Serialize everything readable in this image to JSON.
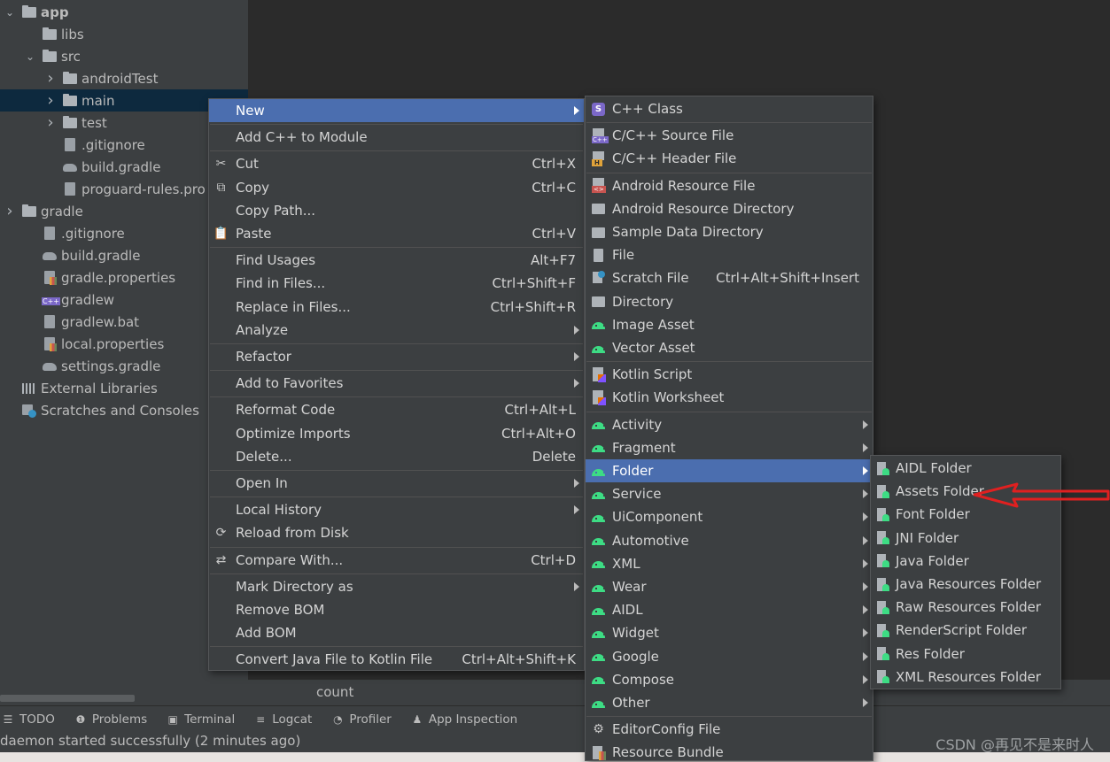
{
  "project_tree": [
    {
      "label": "app",
      "arrow": "down",
      "icon": "module-folder-icon",
      "kind": "folder"
    },
    {
      "label": "libs",
      "arrow": "",
      "icon": "folder-icon",
      "kind": "folder"
    },
    {
      "label": "src",
      "arrow": "down",
      "icon": "folder-icon",
      "kind": "folder"
    },
    {
      "label": "androidTest",
      "arrow": "right",
      "icon": "folder-icon",
      "kind": "folder"
    },
    {
      "label": "main",
      "arrow": "right",
      "icon": "folder-icon",
      "kind": "folder",
      "selected": true
    },
    {
      "label": "test",
      "arrow": "right",
      "icon": "folder-icon",
      "kind": "folder"
    },
    {
      "label": ".gitignore",
      "arrow": "",
      "icon": "gitignore-file-icon",
      "kind": "file"
    },
    {
      "label": "build.gradle",
      "arrow": "",
      "icon": "gradle-icon",
      "kind": "gradle"
    },
    {
      "label": "proguard-rules.pro",
      "arrow": "",
      "icon": "file-icon",
      "kind": "file"
    },
    {
      "label": "gradle",
      "arrow": "right",
      "icon": "folder-icon",
      "kind": "folder"
    },
    {
      "label": ".gitignore",
      "arrow": "",
      "icon": "gitignore-file-icon",
      "kind": "file"
    },
    {
      "label": "build.gradle",
      "arrow": "",
      "icon": "gradle-icon",
      "kind": "gradle"
    },
    {
      "label": "gradle.properties",
      "arrow": "",
      "icon": "properties-icon",
      "kind": "props"
    },
    {
      "label": "gradlew",
      "arrow": "",
      "icon": "cpp-file-icon",
      "kind": "cpp"
    },
    {
      "label": "gradlew.bat",
      "arrow": "",
      "icon": "file-icon",
      "kind": "file"
    },
    {
      "label": "local.properties",
      "arrow": "",
      "icon": "properties-icon",
      "kind": "props"
    },
    {
      "label": "settings.gradle",
      "arrow": "",
      "icon": "gradle-icon",
      "kind": "gradle"
    },
    {
      "label": "External Libraries",
      "arrow": "",
      "icon": "library-icon",
      "kind": "lib"
    },
    {
      "label": "Scratches and Consoles",
      "arrow": "",
      "icon": "scratches-icon",
      "kind": "scratch"
    }
  ],
  "editor": {
    "status_text": "count"
  },
  "context_menu": {
    "items": [
      {
        "label": "New",
        "shortcut": "",
        "submenu": true,
        "highlighted": true,
        "icon": ""
      },
      {
        "sep": true
      },
      {
        "label": "Add C++ to Module",
        "shortcut": "",
        "submenu": false,
        "icon": ""
      },
      {
        "sep": true
      },
      {
        "label": "Cut",
        "shortcut": "Ctrl+X",
        "submenu": false,
        "icon": "scissors-icon",
        "glyph": "✂"
      },
      {
        "label": "Copy",
        "shortcut": "Ctrl+C",
        "submenu": false,
        "icon": "copy-icon",
        "glyph": "⧉"
      },
      {
        "label": "Copy Path...",
        "shortcut": "",
        "submenu": false,
        "icon": ""
      },
      {
        "label": "Paste",
        "shortcut": "Ctrl+V",
        "submenu": false,
        "icon": "clipboard-icon",
        "glyph": "📋"
      },
      {
        "sep": true
      },
      {
        "label": "Find Usages",
        "shortcut": "Alt+F7",
        "submenu": false,
        "icon": ""
      },
      {
        "label": "Find in Files...",
        "shortcut": "Ctrl+Shift+F",
        "submenu": false,
        "icon": ""
      },
      {
        "label": "Replace in Files...",
        "shortcut": "Ctrl+Shift+R",
        "submenu": false,
        "icon": ""
      },
      {
        "label": "Analyze",
        "shortcut": "",
        "submenu": true,
        "icon": ""
      },
      {
        "sep": true
      },
      {
        "label": "Refactor",
        "shortcut": "",
        "submenu": true,
        "icon": ""
      },
      {
        "sep": true
      },
      {
        "label": "Add to Favorites",
        "shortcut": "",
        "submenu": true,
        "icon": ""
      },
      {
        "sep": true
      },
      {
        "label": "Reformat Code",
        "shortcut": "Ctrl+Alt+L",
        "submenu": false,
        "icon": ""
      },
      {
        "label": "Optimize Imports",
        "shortcut": "Ctrl+Alt+O",
        "submenu": false,
        "icon": ""
      },
      {
        "label": "Delete...",
        "shortcut": "Delete",
        "submenu": false,
        "icon": ""
      },
      {
        "sep": true
      },
      {
        "label": "Open In",
        "shortcut": "",
        "submenu": true,
        "icon": ""
      },
      {
        "sep": true
      },
      {
        "label": "Local History",
        "shortcut": "",
        "submenu": true,
        "icon": ""
      },
      {
        "label": "Reload from Disk",
        "shortcut": "",
        "submenu": false,
        "icon": "reload-icon",
        "glyph": "⟳"
      },
      {
        "sep": true
      },
      {
        "label": "Compare With...",
        "shortcut": "Ctrl+D",
        "submenu": false,
        "icon": "compare-icon",
        "glyph": "⇄"
      },
      {
        "sep": true
      },
      {
        "label": "Mark Directory as",
        "shortcut": "",
        "submenu": true,
        "icon": ""
      },
      {
        "label": "Remove BOM",
        "shortcut": "",
        "submenu": false,
        "icon": ""
      },
      {
        "label": "Add BOM",
        "shortcut": "",
        "submenu": false,
        "icon": ""
      },
      {
        "sep": true
      },
      {
        "label": "Convert Java File to Kotlin File",
        "shortcut": "Ctrl+Alt+Shift+K",
        "submenu": false,
        "icon": ""
      }
    ]
  },
  "new_submenu": {
    "items": [
      {
        "label": "C++ Class",
        "icon": "cpp-class-icon",
        "cls": "ic-s"
      },
      {
        "sep": true
      },
      {
        "label": "C/C++ Source File",
        "icon": "cpp-source-file-icon",
        "cls": "ic-cpp"
      },
      {
        "label": "C/C++ Header File",
        "icon": "cpp-header-file-icon",
        "cls": "ic-h"
      },
      {
        "sep": true
      },
      {
        "label": "Android Resource File",
        "icon": "android-resource-file-icon",
        "cls": "ic-res"
      },
      {
        "label": "Android Resource Directory",
        "icon": "folder-icon",
        "cls": "ic-folder"
      },
      {
        "label": "Sample Data Directory",
        "icon": "folder-icon",
        "cls": "ic-folder"
      },
      {
        "label": "File",
        "icon": "file-icon",
        "cls": "ic-file"
      },
      {
        "label": "Scratch File",
        "shortcut": "Ctrl+Alt+Shift+Insert",
        "icon": "scratch-file-icon",
        "cls": "ic-scratch"
      },
      {
        "label": "Directory",
        "icon": "folder-icon",
        "cls": "ic-folder"
      },
      {
        "label": "Image Asset",
        "icon": "android-icon",
        "cls": "ic-android"
      },
      {
        "label": "Vector Asset",
        "icon": "android-icon",
        "cls": "ic-android"
      },
      {
        "sep": true
      },
      {
        "label": "Kotlin Script",
        "icon": "kotlin-file-icon",
        "cls": "ic-kotlin"
      },
      {
        "label": "Kotlin Worksheet",
        "icon": "kotlin-file-icon",
        "cls": "ic-kotlin"
      },
      {
        "sep": true
      },
      {
        "label": "Activity",
        "submenu": true,
        "icon": "android-icon",
        "cls": "ic-android"
      },
      {
        "label": "Fragment",
        "submenu": true,
        "icon": "android-icon",
        "cls": "ic-android"
      },
      {
        "label": "Folder",
        "submenu": true,
        "highlighted": true,
        "icon": "android-icon",
        "cls": "ic-android"
      },
      {
        "label": "Service",
        "submenu": true,
        "icon": "android-icon",
        "cls": "ic-android"
      },
      {
        "label": "UiComponent",
        "submenu": true,
        "icon": "android-icon",
        "cls": "ic-android"
      },
      {
        "label": "Automotive",
        "submenu": true,
        "icon": "android-icon",
        "cls": "ic-android"
      },
      {
        "label": "XML",
        "submenu": true,
        "icon": "android-icon",
        "cls": "ic-android"
      },
      {
        "label": "Wear",
        "submenu": true,
        "icon": "android-icon",
        "cls": "ic-android"
      },
      {
        "label": "AIDL",
        "submenu": true,
        "icon": "android-icon",
        "cls": "ic-android"
      },
      {
        "label": "Widget",
        "submenu": true,
        "icon": "android-icon",
        "cls": "ic-android"
      },
      {
        "label": "Google",
        "submenu": true,
        "icon": "android-icon",
        "cls": "ic-android"
      },
      {
        "label": "Compose",
        "submenu": true,
        "icon": "android-icon",
        "cls": "ic-android"
      },
      {
        "label": "Other",
        "submenu": true,
        "icon": "android-icon",
        "cls": "ic-android"
      },
      {
        "sep": true
      },
      {
        "label": "EditorConfig File",
        "icon": "gear-icon",
        "cls": "",
        "glyph": "⚙"
      },
      {
        "label": "Resource Bundle",
        "icon": "resource-bundle-icon",
        "cls": "ic-bundle"
      }
    ]
  },
  "folder_submenu": {
    "items": [
      {
        "label": "AIDL Folder"
      },
      {
        "label": "Assets Folder"
      },
      {
        "label": "Font Folder"
      },
      {
        "label": "JNI Folder"
      },
      {
        "label": "Java Folder"
      },
      {
        "label": "Java Resources Folder"
      },
      {
        "label": "Raw Resources Folder"
      },
      {
        "label": "RenderScript Folder"
      },
      {
        "label": "Res Folder"
      },
      {
        "label": "XML Resources Folder"
      }
    ]
  },
  "tool_tabs": [
    {
      "label": "TODO",
      "icon": "todo-icon",
      "glyph": "☰"
    },
    {
      "label": "Problems",
      "icon": "problems-icon",
      "glyph": "❶"
    },
    {
      "label": "Terminal",
      "icon": "terminal-icon",
      "glyph": "▣"
    },
    {
      "label": "Logcat",
      "icon": "logcat-icon",
      "glyph": "≡"
    },
    {
      "label": "Profiler",
      "icon": "profiler-icon",
      "glyph": "◔"
    },
    {
      "label": "App Inspection",
      "icon": "app-inspection-icon",
      "glyph": "♟"
    }
  ],
  "status_bar": {
    "message": "daemon started successfully (2 minutes ago)",
    "watermark": "CSDN @再见不是来时人"
  },
  "annotation": {
    "arrow_color": "#e02020"
  }
}
